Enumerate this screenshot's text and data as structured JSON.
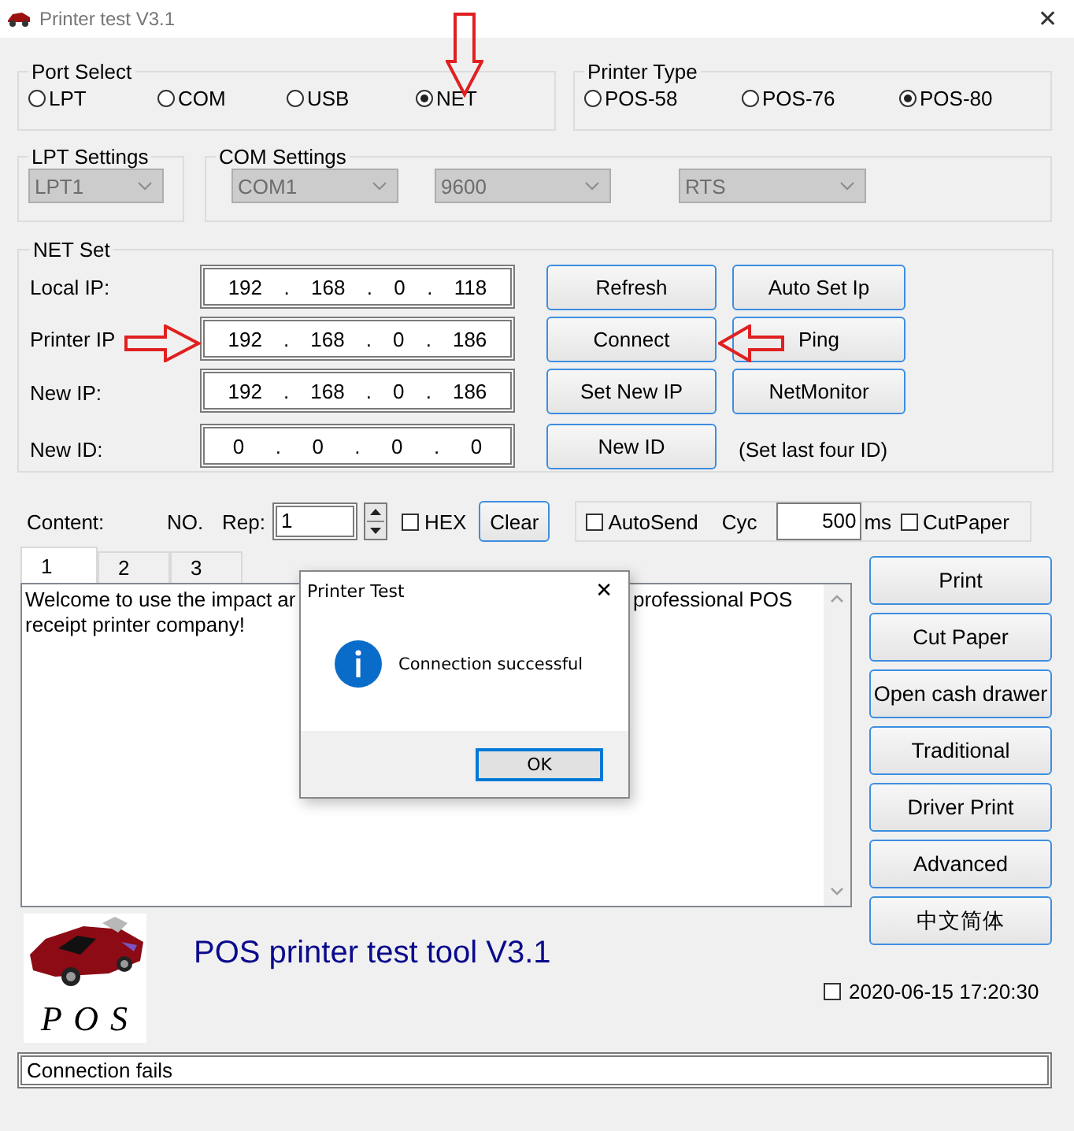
{
  "window": {
    "title": "Printer test V3.1",
    "close": "✕"
  },
  "port_select": {
    "label": "Port Select",
    "options": [
      {
        "label": "LPT",
        "selected": false
      },
      {
        "label": "COM",
        "selected": false
      },
      {
        "label": "USB",
        "selected": false
      },
      {
        "label": "NET",
        "selected": true
      }
    ]
  },
  "printer_type": {
    "label": "Printer Type",
    "options": [
      {
        "label": "POS-58",
        "selected": false
      },
      {
        "label": "POS-76",
        "selected": false
      },
      {
        "label": "POS-80",
        "selected": true
      }
    ]
  },
  "lpt_settings": {
    "label": "LPT Settings",
    "combos": [
      {
        "value": "LPT1",
        "disabled": true
      }
    ]
  },
  "com_settings": {
    "label": "COM Settings",
    "combos": [
      {
        "value": "COM1",
        "disabled": true
      },
      {
        "value": "9600",
        "disabled": true
      },
      {
        "value": "RTS",
        "disabled": true
      }
    ]
  },
  "net_set": {
    "label": "NET Set",
    "separator": ".",
    "fields": [
      {
        "label": "Local IP:",
        "octets": [
          "192",
          "168",
          "0",
          "118"
        ]
      },
      {
        "label": "Printer IP",
        "octets": [
          "192",
          "168",
          "0",
          "186"
        ]
      },
      {
        "label": "New IP:",
        "octets": [
          "192",
          "168",
          "0",
          "186"
        ]
      },
      {
        "label": "New ID:",
        "octets": [
          "0",
          "0",
          "0",
          "0"
        ]
      }
    ],
    "buttons": [
      "Refresh",
      "Auto Set Ip",
      "Connect",
      "Ping",
      "Set New IP",
      "NetMonitor",
      "New ID"
    ],
    "note": "(Set last four ID)"
  },
  "content_bar": {
    "content_label": "Content:",
    "no_label": "NO.",
    "rep_label": "Rep:",
    "rep_value": "1",
    "hex": {
      "label": "HEX",
      "checked": false
    },
    "clear": "Clear",
    "autosend": {
      "label": "AutoSend",
      "checked": false
    },
    "cyc_label": "Cyc",
    "cyc_value": "500",
    "ms_label": "ms",
    "cut_paper": {
      "label": "CutPaper",
      "checked": false
    }
  },
  "tabs": [
    {
      "label": "1",
      "selected": true
    },
    {
      "label": "2",
      "selected": false
    },
    {
      "label": "3",
      "selected": false
    }
  ],
  "content_text": {
    "line_1_start": "Welcome to use the impact ar",
    "line_1_end": "professional POS",
    "line_2": "receipt printer company!"
  },
  "side_buttons": [
    "Print",
    "Cut Paper",
    "Open cash drawer",
    "Traditional",
    "Driver Print",
    "Advanced",
    "中文简体"
  ],
  "logo_text": "P O S",
  "app_title": "POS printer test tool V3.1",
  "timestamp": {
    "label": "2020-06-15 17:20:30",
    "checked": false
  },
  "status": "Connection fails",
  "dialog": {
    "title": "Printer Test",
    "close": "✕",
    "message": "Connection successful",
    "ok": "OK"
  }
}
